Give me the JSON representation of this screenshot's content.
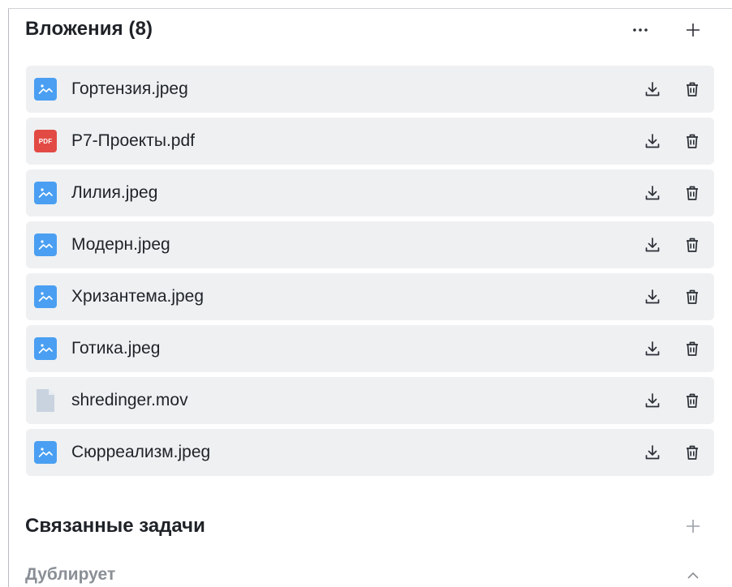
{
  "attachments": {
    "title": "Вложения (8)",
    "more_icon": "more-horizontal-icon",
    "add_icon": "plus-icon",
    "files": [
      {
        "name": "Гортензия.jpeg",
        "type": "image"
      },
      {
        "name": "P7-Проекты.pdf",
        "type": "pdf",
        "badge": "PDF"
      },
      {
        "name": "Лилия.jpeg",
        "type": "image"
      },
      {
        "name": "Модерн.jpeg",
        "type": "image"
      },
      {
        "name": "Хризантема.jpeg",
        "type": "image"
      },
      {
        "name": "Готика.jpeg",
        "type": "image"
      },
      {
        "name": "shredinger.mov",
        "type": "generic"
      },
      {
        "name": "Сюрреализм.jpeg",
        "type": "image"
      }
    ]
  },
  "related_tasks": {
    "title": "Связанные задачи",
    "add_icon": "plus-icon"
  },
  "duplicates": {
    "label": "Дублирует",
    "icon": "chevron-up-icon"
  },
  "colors": {
    "image_icon": "#4a9ff2",
    "pdf_icon": "#e24b44",
    "row_background": "#eef0f2",
    "generic_icon": "#c9d3df"
  }
}
